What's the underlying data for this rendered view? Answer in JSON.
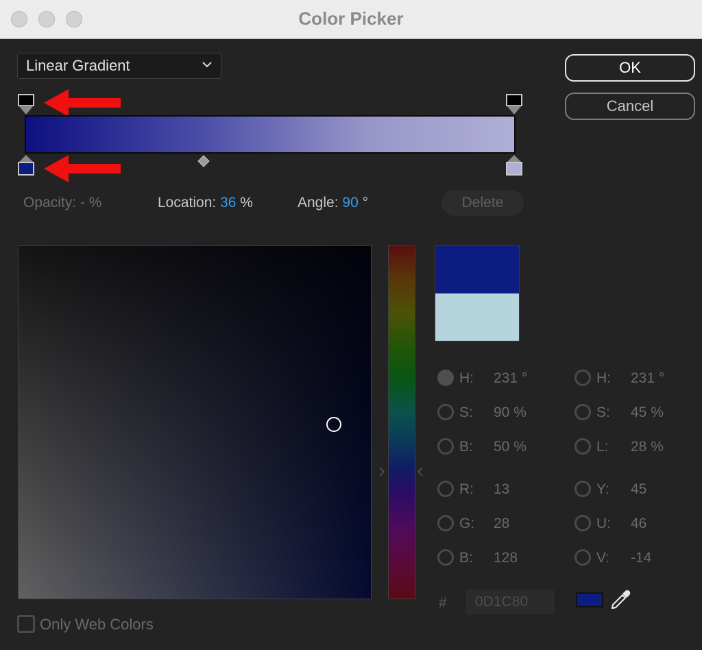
{
  "window": {
    "title": "Color Picker"
  },
  "gradient_type": {
    "selected": "Linear Gradient"
  },
  "buttons": {
    "ok": "OK",
    "cancel": "Cancel",
    "delete": "Delete"
  },
  "stop_fields": {
    "opacity_label": "Opacity:",
    "opacity_value": "- %",
    "location_label": "Location:",
    "location_value": "36",
    "location_unit": "%",
    "angle_label": "Angle:",
    "angle_value": "90",
    "angle_unit": "°"
  },
  "colors": {
    "new": "#0d1c80",
    "original": "#b5d4de",
    "accent": "#3b9bef"
  },
  "hsb": {
    "h_label": "H:",
    "h_value": "231 °",
    "s_label": "S:",
    "s_value": "90 %",
    "b_label": "B:",
    "b_value": "50 %"
  },
  "hsl": {
    "h_label": "H:",
    "h_value": "231 °",
    "s_label": "S:",
    "s_value": "45 %",
    "l_label": "L:",
    "l_value": "28 %"
  },
  "rgb": {
    "r_label": "R:",
    "r_value": "13",
    "g_label": "G:",
    "g_value": "28",
    "b_label": "B:",
    "b_value": "128"
  },
  "yuv": {
    "y_label": "Y:",
    "y_value": "45",
    "u_label": "U:",
    "u_value": "46",
    "v_label": "V:",
    "v_value": "-14"
  },
  "hex": {
    "hash": "#",
    "value": "0D1C80"
  },
  "web_colors": {
    "label": "Only Web Colors",
    "checked": false
  },
  "icons": {
    "dropdown": "chevron-down-icon",
    "eyedropper": "eyedropper-icon",
    "annotation": "red-arrow-icon"
  }
}
